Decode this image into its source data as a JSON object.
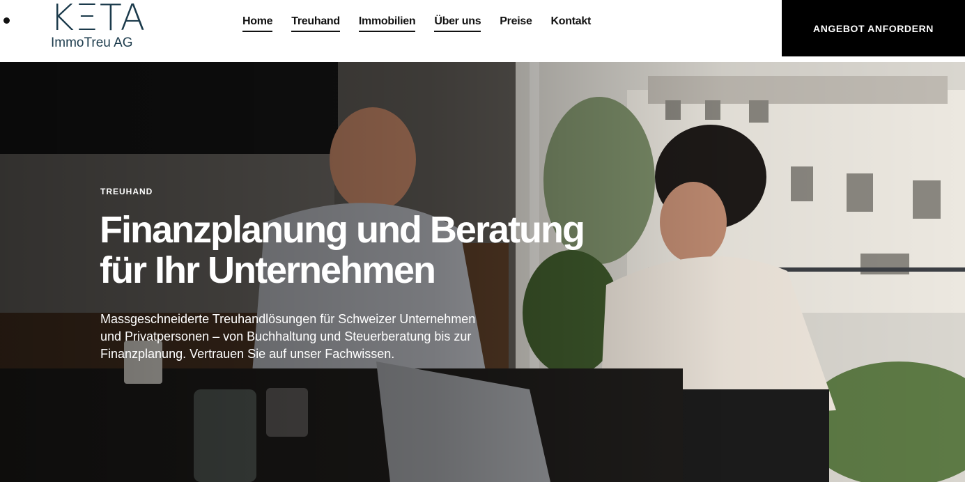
{
  "header": {
    "logo": {
      "wordmark": "KΞTA",
      "subtitle": "ImmoTreu AG"
    },
    "nav": [
      {
        "label": "Home",
        "underlined": true
      },
      {
        "label": "Treuhand",
        "underlined": true
      },
      {
        "label": "Immobilien",
        "underlined": true
      },
      {
        "label": "Über uns",
        "underlined": true
      },
      {
        "label": "Preise",
        "underlined": false
      },
      {
        "label": "Kontakt",
        "underlined": false
      }
    ],
    "cta_label": "ANGEBOT ANFORDERN"
  },
  "hero": {
    "eyebrow": "TREUHAND",
    "title_line1": "Finanzplanung und Beratung",
    "title_line2": "für Ihr Unternehmen",
    "description": "Massgeschneiderte Treuhandlösungen für Schweizer Unternehmen und Privatpersonen – von Buchhaltung und Steuerberatung bis zur Finanzplanung. Vertrauen Sie auf unser Fachwissen.",
    "image": "office-meeting-photo"
  },
  "colors": {
    "brand": "#1b3a4b",
    "cta_bg": "#000000",
    "text_on_hero": "#ffffff"
  }
}
